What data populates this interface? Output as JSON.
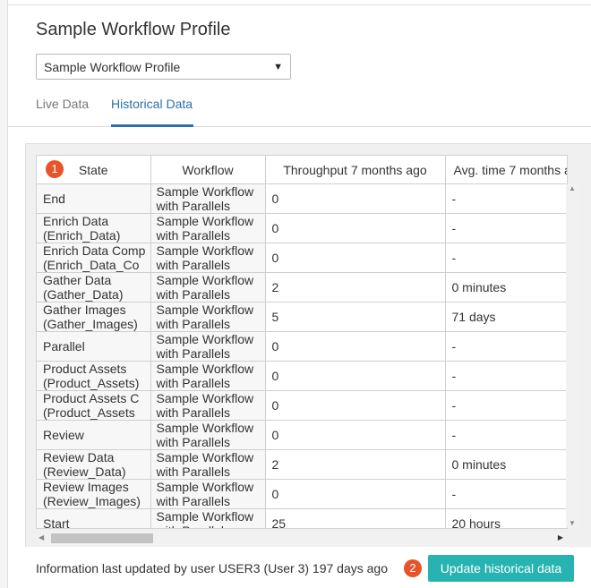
{
  "page": {
    "title": "Sample Workflow Profile"
  },
  "profile_select": {
    "value": "Sample Workflow Profile"
  },
  "tabs": [
    {
      "label": "Live Data",
      "active": false
    },
    {
      "label": "Historical Data",
      "active": true
    }
  ],
  "table": {
    "badge": "1",
    "headers": [
      "State",
      "Workflow",
      "Throughput 7 months ago",
      "Avg. time 7 months a"
    ],
    "rows": [
      {
        "state": [
          "End",
          ""
        ],
        "workflow": [
          "Sample Workflow",
          "with Parallels"
        ],
        "throughput": "0",
        "avg_time": "-"
      },
      {
        "state": [
          "Enrich Data",
          "(Enrich_Data)"
        ],
        "workflow": [
          "Sample Workflow",
          "with Parallels"
        ],
        "throughput": "0",
        "avg_time": "-"
      },
      {
        "state": [
          "Enrich Data Comp",
          "(Enrich_Data_Co"
        ],
        "workflow": [
          "Sample Workflow",
          "with Parallels"
        ],
        "throughput": "0",
        "avg_time": "-"
      },
      {
        "state": [
          "Gather Data",
          "(Gather_Data)"
        ],
        "workflow": [
          "Sample Workflow",
          "with Parallels"
        ],
        "throughput": "2",
        "avg_time": "0 minutes"
      },
      {
        "state": [
          "Gather Images",
          "(Gather_Images)"
        ],
        "workflow": [
          "Sample Workflow",
          "with Parallels"
        ],
        "throughput": "5",
        "avg_time": "71 days"
      },
      {
        "state": [
          "Parallel",
          ""
        ],
        "workflow": [
          "Sample Workflow",
          "with Parallels"
        ],
        "throughput": "0",
        "avg_time": "-"
      },
      {
        "state": [
          "Product Assets",
          "(Product_Assets)"
        ],
        "workflow": [
          "Sample Workflow",
          "with Parallels"
        ],
        "throughput": "0",
        "avg_time": "-"
      },
      {
        "state": [
          "Product Assets C",
          "(Product_Assets"
        ],
        "workflow": [
          "Sample Workflow",
          "with Parallels"
        ],
        "throughput": "0",
        "avg_time": "-"
      },
      {
        "state": [
          "Review",
          ""
        ],
        "workflow": [
          "Sample Workflow",
          "with Parallels"
        ],
        "throughput": "0",
        "avg_time": "-"
      },
      {
        "state": [
          "Review Data",
          "(Review_Data)"
        ],
        "workflow": [
          "Sample Workflow",
          "with Parallels"
        ],
        "throughput": "2",
        "avg_time": "0 minutes"
      },
      {
        "state": [
          "Review Images",
          "(Review_Images)"
        ],
        "workflow": [
          "Sample Workflow",
          "with Parallels"
        ],
        "throughput": "0",
        "avg_time": "-"
      },
      {
        "state": [
          "Start",
          ""
        ],
        "workflow": [
          "Sample Workflow",
          "with Parallels"
        ],
        "throughput": "25",
        "avg_time": "20 hours"
      }
    ]
  },
  "footer": {
    "info": "Information last updated by user USER3 (User 3) 197 days ago",
    "badge": "2",
    "update_button": "Update historical data"
  }
}
